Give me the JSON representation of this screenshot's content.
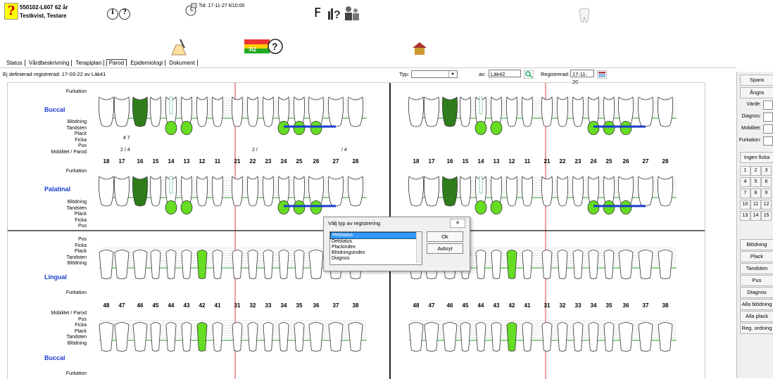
{
  "header": {
    "patient_id": "550102-L607   62 år",
    "patient_name": "Testkvist, Testare",
    "info_btn": "i",
    "help_btn": "?",
    "appointment": "Tid: 17-11-27 kl10:00",
    "f_label": "F",
    "r2_badge": "R2"
  },
  "tabs": [
    {
      "label": "Status"
    },
    {
      "label": "Vårdbeskrivning"
    },
    {
      "label": "Terapiplan"
    },
    {
      "label": "Parod"
    },
    {
      "label": "Epidemiologi"
    },
    {
      "label": "Dokument"
    }
  ],
  "toolbar": {
    "registered_note": "Ej definierad registrerad: 17-03-22 av Läk41",
    "typ_label": "Typ:",
    "typ_value": "",
    "av_label": "av:",
    "av_value": "Läk42",
    "registrerad_label": "Registrerad:",
    "registrerad_value": "17-11-20"
  },
  "sidebar": {
    "spara": "Spara",
    "angra": "Ångra",
    "varde": "Värde:",
    "diagnos_field": "Diagnos:",
    "mobilitet": "Mobilitet:",
    "furkation": "Furkation:",
    "ingen_ficka": "Ingen ficka",
    "numbers": [
      "1",
      "2",
      "3",
      "4",
      "5",
      "6",
      "7",
      "8",
      "9",
      "10",
      "11",
      "12",
      "13",
      "14",
      "15"
    ],
    "blodning": "Blödning",
    "plack": "Plack",
    "tandsten": "Tandsten",
    "pus": "Pus",
    "diagnos": "Diagnos",
    "alla_blodning": "Alla blödning",
    "alla_plack": "Alla plack",
    "reg_ordning": "Reg. ordning"
  },
  "chart": {
    "upper_buccal": {
      "furkation": "Furkation",
      "title": "Buccal",
      "labels": [
        "Blödning",
        "Tandsten",
        "Plack",
        "Ficka",
        "Pus",
        "Mobilitet / Parod"
      ],
      "ficka_17": "4 7",
      "mob_17": "2 / 4",
      "mob_22": "2 /",
      "mob_27": "/ 4"
    },
    "upper_palatal": {
      "furkation": "Furkation",
      "title": "Palatinal",
      "labels": [
        "Blödning",
        "Tandsten",
        "Plack",
        "Ficka",
        "Pus"
      ]
    },
    "lower_lingual": {
      "labels": [
        "Pus",
        "Ficka",
        "Plack",
        "Tandsten",
        "Blödning"
      ],
      "title": "Lingual",
      "furkation": "Furkation"
    },
    "lower_buccal": {
      "labels": [
        "Mobilitet / Parod",
        "Pus",
        "Ficka",
        "Plack",
        "Tandsten",
        "Blödning"
      ],
      "title": "Buccal",
      "furkation": "Furkation"
    },
    "upper_numbers": [
      "18",
      "17",
      "16",
      "15",
      "14",
      "13",
      "12",
      "11",
      "21",
      "22",
      "23",
      "24",
      "25",
      "26",
      "27",
      "28"
    ],
    "lower_numbers": [
      "48",
      "47",
      "46",
      "45",
      "44",
      "43",
      "42",
      "41",
      "31",
      "32",
      "33",
      "34",
      "35",
      "36",
      "37",
      "38"
    ]
  },
  "dialog": {
    "title": "Välj typ av registrering",
    "close": "✕",
    "options": [
      "Helstatus",
      "Delstatus",
      "Plackindex",
      "Blödningsindex",
      "Diagnos"
    ],
    "selected": "Helstatus",
    "ok": "Ok",
    "cancel": "Avbryt"
  },
  "colors": {
    "bright_green": "#66dd22",
    "dark_green": "#2e7d1a",
    "section_blue": "#1a3ccc",
    "red_line": "#e33333",
    "gum_line": "#2a9a2a",
    "bar_blue": "#1a3ccc"
  }
}
